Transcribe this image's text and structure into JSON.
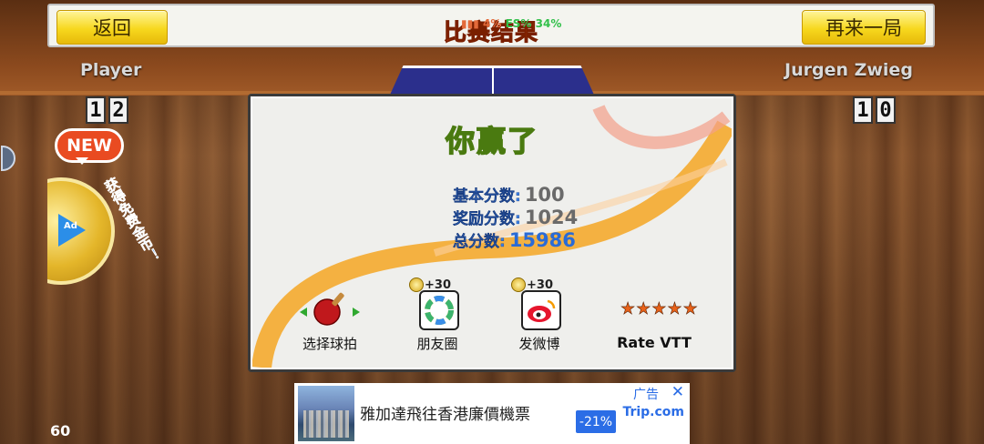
{
  "topbar": {
    "back_label": "返回",
    "title": "比赛结果",
    "again_label": "再来一局",
    "status_signal": "4%",
    "status_net": "ES%",
    "status_battery": "34%"
  },
  "players": {
    "left": {
      "name": "Player",
      "score_digits": [
        "1",
        "2"
      ]
    },
    "right": {
      "name": "Jurgen Zwieg",
      "score_digits": [
        "1",
        "0"
      ]
    }
  },
  "promo": {
    "new_badge": "NEW",
    "coin_label": "Ad",
    "vertical_text": "获得免费金币！"
  },
  "dialog": {
    "title": "你赢了",
    "base_label": "基本分数:",
    "base_value": "100",
    "bonus_label": "奖励分数:",
    "bonus_value": "1024",
    "total_label": "总分数:",
    "total_value": "15986",
    "options": [
      {
        "label": "选择球拍",
        "icon": "paddle-icon"
      },
      {
        "label": "朋友圈",
        "icon": "moments-icon",
        "bonus": "+30"
      },
      {
        "label": "发微博",
        "icon": "weibo-icon",
        "bonus": "+30"
      },
      {
        "label": "Rate VTT",
        "icon": "stars-icon"
      }
    ]
  },
  "ad": {
    "text": "雅加達飛往香港廉價機票",
    "discount": "-21%",
    "tag": "广告",
    "close": "✕",
    "brand": "Trip.com"
  },
  "fps": "60",
  "colors": {
    "accent_yellow": "#f7d81e",
    "title_orange": "#e8491d",
    "win_green": "#b8df4a",
    "score_blue": "#3a7de0"
  }
}
